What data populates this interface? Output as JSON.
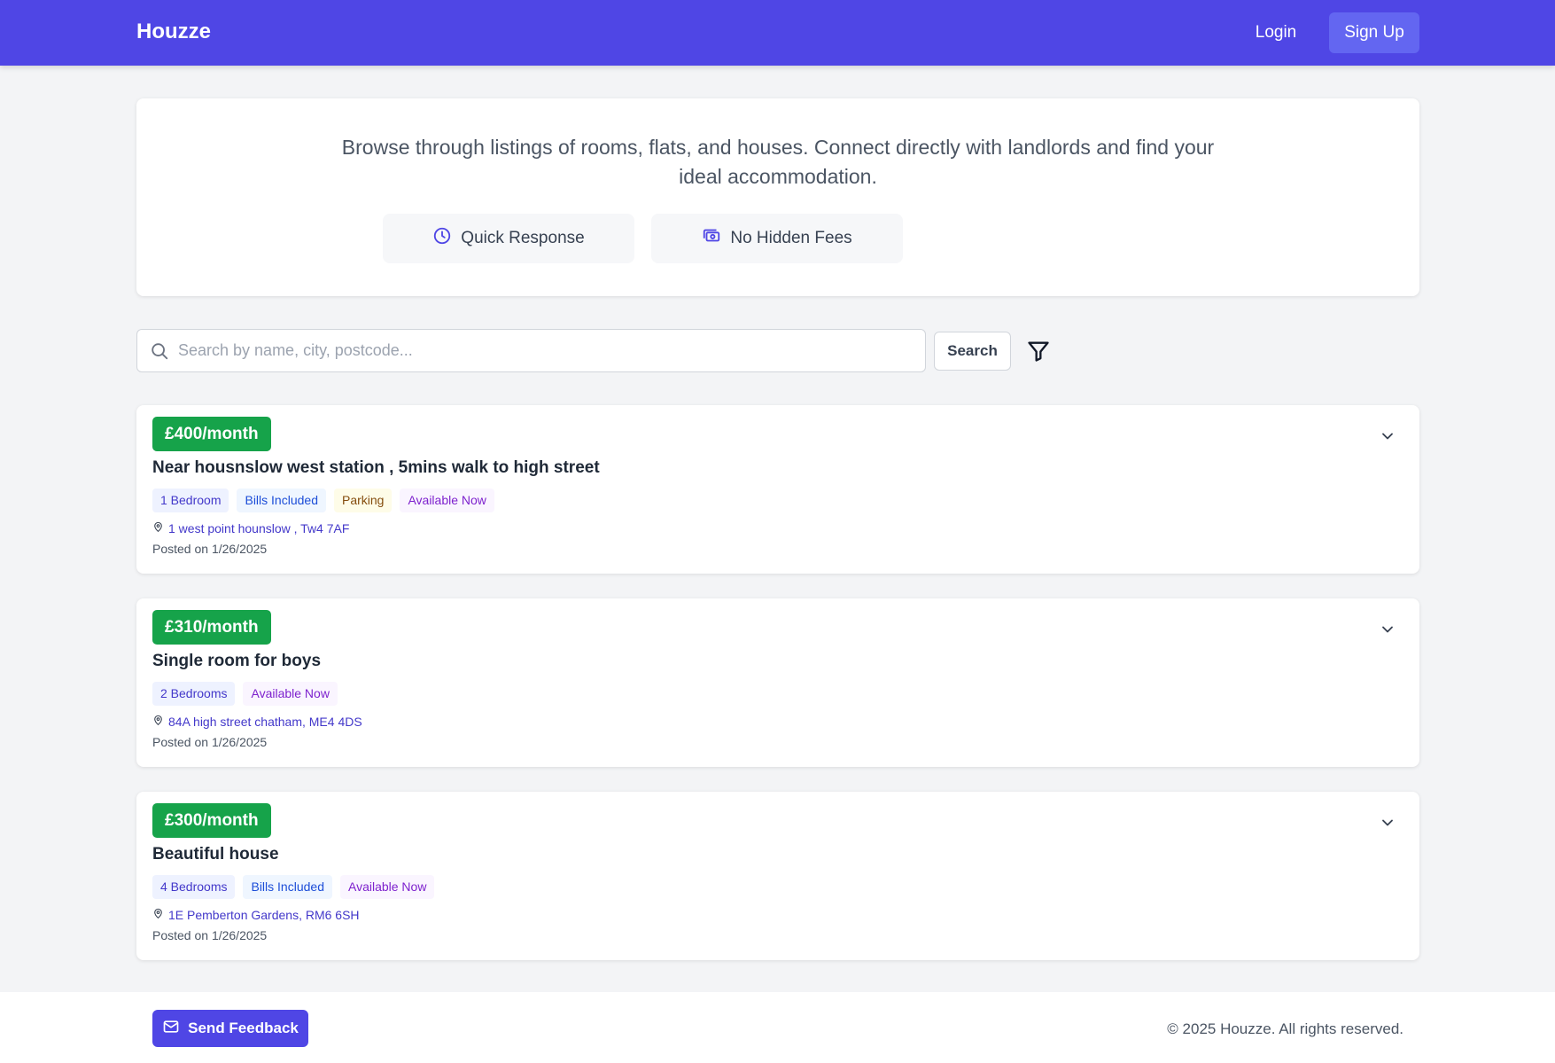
{
  "header": {
    "brand": "Houzze",
    "login_label": "Login",
    "signup_label": "Sign Up"
  },
  "hero": {
    "text": "Browse through listings of rooms, flats, and houses. Connect directly with landlords and find your ideal accommodation.",
    "features": [
      {
        "label": "Quick Response",
        "icon": "clock-icon"
      },
      {
        "label": "No Hidden Fees",
        "icon": "cash-icon"
      }
    ]
  },
  "search": {
    "placeholder": "Search by name, city, postcode...",
    "value": "",
    "button_label": "Search"
  },
  "listings": [
    {
      "price": "£400/month",
      "title": "Near housnslow west station , 5mins walk to high street",
      "tags": [
        {
          "label": "1 Bedroom",
          "color": "#4338ca"
        },
        {
          "label": "Bills Included",
          "color": "#1d4ed8"
        },
        {
          "label": "Parking",
          "color": "#854d0e"
        },
        {
          "label": "Available Now",
          "color": "#7e22ce"
        }
      ],
      "address": "1 west point hounslow , Tw4 7AF",
      "posted": "Posted on 1/26/2025"
    },
    {
      "price": "£310/month",
      "title": "Single room for boys",
      "tags": [
        {
          "label": "2 Bedrooms",
          "color": "#4338ca"
        },
        {
          "label": "Available Now",
          "color": "#7e22ce"
        }
      ],
      "address": "84A high street chatham, ME4 4DS",
      "posted": "Posted on 1/26/2025"
    },
    {
      "price": "£300/month",
      "title": "Beautiful house",
      "tags": [
        {
          "label": "4 Bedrooms",
          "color": "#4338ca"
        },
        {
          "label": "Bills Included",
          "color": "#1d4ed8"
        },
        {
          "label": "Available Now",
          "color": "#7e22ce"
        }
      ],
      "address": "1E Pemberton Gardens, RM6 6SH",
      "posted": "Posted on 1/26/2025"
    }
  ],
  "footer": {
    "feedback_label": "Send Feedback",
    "copyright": "© 2025 Houzze. All rights reserved."
  },
  "colors": {
    "brand": "#4f46e5",
    "price": "#16a34a"
  }
}
